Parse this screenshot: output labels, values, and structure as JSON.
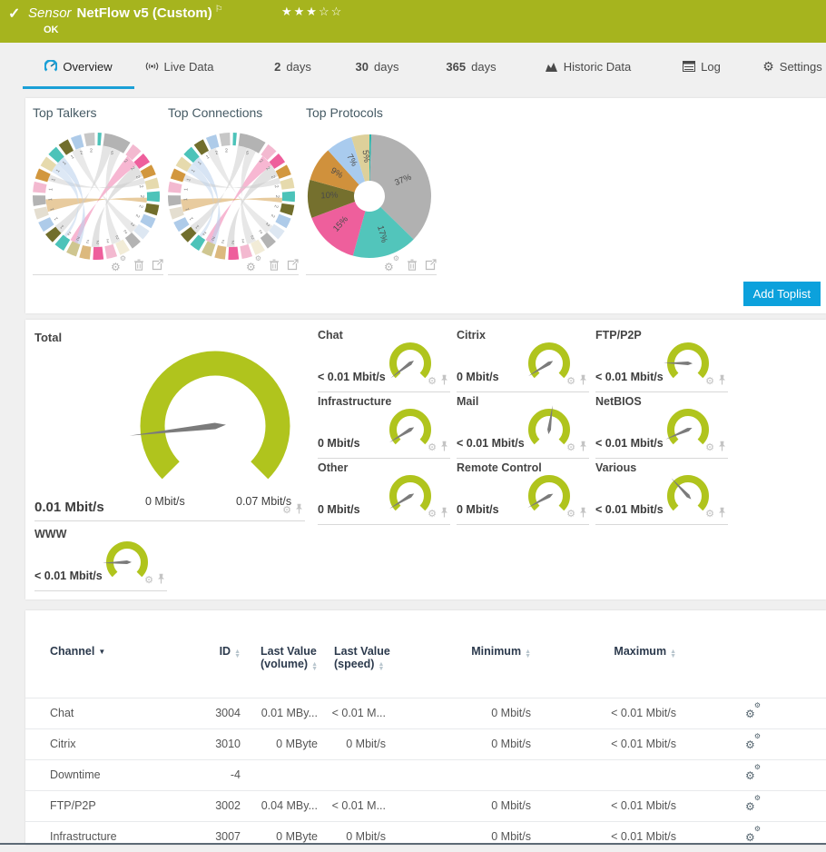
{
  "header": {
    "check_icon": "✓",
    "title_prefix": "Sensor",
    "title": "NetFlow v5 (Custom)",
    "flag_icon": "⚐",
    "stars": "★★★☆☆",
    "status": "OK"
  },
  "tabs": {
    "overview": "Overview",
    "live_data": "Live Data",
    "d2_num": "2",
    "d2_unit": "days",
    "d30_num": "30",
    "d30_unit": "days",
    "d365_num": "365",
    "d365_unit": "days",
    "historic": "Historic Data",
    "log": "Log",
    "settings": "Settings"
  },
  "toplists": {
    "talkers_title": "Top Talkers",
    "connections_title": "Top Connections",
    "protocols_title": "Top Protocols",
    "add_button": "Add Toplist"
  },
  "gauges": {
    "total": {
      "title": "Total",
      "value": "0.01 Mbit/s",
      "min_label": "0 Mbit/s",
      "max_label": "0.07 Mbit/s",
      "fraction": 0.143
    },
    "small": [
      {
        "title": "Chat",
        "value": "< 0.01 Mbit/s",
        "fraction": 0.03
      },
      {
        "title": "Citrix",
        "value": "0 Mbit/s",
        "fraction": 0.05
      },
      {
        "title": "FTP/P2P",
        "value": "< 0.01 Mbit/s",
        "fraction": 0.17
      },
      {
        "title": "Infrastructure",
        "value": "0 Mbit/s",
        "fraction": 0.05
      },
      {
        "title": "Mail",
        "value": "< 0.01 Mbit/s",
        "fraction": 0.53
      },
      {
        "title": "NetBIOS",
        "value": "< 0.01 Mbit/s",
        "fraction": 0.08
      },
      {
        "title": "Other",
        "value": "0 Mbit/s",
        "fraction": 0.05
      },
      {
        "title": "Remote Control",
        "value": "0 Mbit/s",
        "fraction": 0.06
      },
      {
        "title": "Various",
        "value": "< 0.01 Mbit/s",
        "fraction": 0.34
      },
      {
        "title": "WWW",
        "value": "< 0.01 Mbit/s",
        "fraction": 0.16
      }
    ]
  },
  "table": {
    "headers": {
      "channel": "Channel",
      "id": "ID",
      "lv_volume_1": "Last Value",
      "lv_volume_2": "(volume)",
      "lv_speed_1": "Last Value",
      "lv_speed_2": "(speed)",
      "minimum": "Minimum",
      "maximum": "Maximum"
    },
    "rows": [
      {
        "channel": "Chat",
        "id": "3004",
        "lv_volume": "0.01 MBy...",
        "lv_speed": "< 0.01 M...",
        "min": "0 Mbit/s",
        "max": "< 0.01 Mbit/s"
      },
      {
        "channel": "Citrix",
        "id": "3010",
        "lv_volume": "0 MByte",
        "lv_speed": "0 Mbit/s",
        "min": "0 Mbit/s",
        "max": "< 0.01 Mbit/s"
      },
      {
        "channel": "Downtime",
        "id": "-4",
        "lv_volume": "",
        "lv_speed": "",
        "min": "",
        "max": ""
      },
      {
        "channel": "FTP/P2P",
        "id": "3002",
        "lv_volume": "0.04 MBy...",
        "lv_speed": "< 0.01 M...",
        "min": "0 Mbit/s",
        "max": "< 0.01 Mbit/s"
      },
      {
        "channel": "Infrastructure",
        "id": "3007",
        "lv_volume": "0 MByte",
        "lv_speed": "0 Mbit/s",
        "min": "0 Mbit/s",
        "max": "< 0.01 Mbit/s"
      }
    ]
  },
  "chart_data": {
    "top_protocols": {
      "type": "pie",
      "title": "Top Protocols",
      "labels": [
        "",
        "37%",
        "17%",
        "15%",
        "10%",
        "9%",
        "7%",
        "5%"
      ],
      "values": [
        0.5,
        36.8,
        17,
        15,
        10,
        9,
        7,
        4.7
      ],
      "colors": [
        "#2ab5ab",
        "#b1b1b1",
        "#52c5bb",
        "#ee5f9c",
        "#75702e",
        "#d0913c",
        "#a9cbee",
        "#ddd09a"
      ]
    },
    "top_talkers": {
      "type": "chord",
      "title": "Top Talkers",
      "template": "chord_template"
    },
    "top_connections": {
      "type": "chord",
      "title": "Top Connections",
      "template": "chord_template"
    },
    "chord_template": {
      "segments": [
        {
          "c": "#4cc3b9",
          "w": 0.5,
          "label": ""
        },
        {
          "c": "#b3b3b3",
          "w": 2.2,
          "label": "5"
        },
        {
          "c": "#f3b9d0",
          "w": 1,
          "label": "2"
        },
        {
          "c": "#ee5f9c",
          "w": 1,
          "label": "2"
        },
        {
          "c": "#d2973e",
          "w": 1,
          "label": "2"
        },
        {
          "c": "#e6daad",
          "w": 1,
          "label": "2"
        },
        {
          "c": "#4cc3b9",
          "w": 1,
          "label": "2"
        },
        {
          "c": "#716e2c",
          "w": 1,
          "label": "2"
        },
        {
          "c": "#aecbe9",
          "w": 1,
          "label": "2"
        },
        {
          "c": "#dde7f2",
          "w": 1,
          "label": "2"
        },
        {
          "c": "#b3b3b3",
          "w": 1,
          "label": "2"
        },
        {
          "c": "#f2ecd7",
          "w": 1,
          "label": "2"
        },
        {
          "c": "#f3b9d0",
          "w": 1,
          "label": "2"
        },
        {
          "c": "#ee5f9c",
          "w": 1,
          "label": "2"
        },
        {
          "c": "#dcb97e",
          "w": 1,
          "label": "2"
        },
        {
          "c": "#cfc690",
          "w": 1,
          "label": "2"
        },
        {
          "c": "#4cc3b9",
          "w": 1,
          "label": "2"
        },
        {
          "c": "#716e2c",
          "w": 1,
          "label": "1"
        },
        {
          "c": "#aecbe9",
          "w": 1,
          "label": "1"
        },
        {
          "c": "#e4ded0",
          "w": 1,
          "label": "1"
        },
        {
          "c": "#b3b3b3",
          "w": 1,
          "label": "1"
        },
        {
          "c": "#f3b9d0",
          "w": 1,
          "label": "1"
        },
        {
          "c": "#d2973e",
          "w": 1,
          "label": "1"
        },
        {
          "c": "#e6daad",
          "w": 1,
          "label": "1"
        },
        {
          "c": "#4cc3b9",
          "w": 1,
          "label": "1"
        },
        {
          "c": "#716e2c",
          "w": 1,
          "label": "1"
        },
        {
          "c": "#aecbe9",
          "w": 1,
          "label": "2"
        },
        {
          "c": "#c7c7c7",
          "w": 1,
          "label": "2"
        }
      ],
      "chords": [
        {
          "a": [
            0.145,
            0.185
          ],
          "b": [
            0.49,
            0.515
          ],
          "c": "#c9c9c9",
          "o": 0.55
        },
        {
          "a": [
            0.105,
            0.145
          ],
          "b": [
            0.56,
            0.585
          ],
          "c": "#ee5f9c",
          "o": 0.45
        },
        {
          "a": [
            0.7,
            0.74
          ],
          "b": [
            0.255,
            0.27
          ],
          "c": "#d2973e",
          "o": 0.5
        },
        {
          "a": [
            0.02,
            0.05
          ],
          "b": [
            0.62,
            0.65
          ],
          "c": "#c9c9c9",
          "o": 0.5
        },
        {
          "a": [
            0.05,
            0.08
          ],
          "b": [
            0.42,
            0.45
          ],
          "c": "#d4d4d4",
          "o": 0.55
        },
        {
          "a": [
            0.86,
            0.89
          ],
          "b": [
            0.55,
            0.57
          ],
          "c": "#bcd2ec",
          "o": 0.6
        },
        {
          "a": [
            0.92,
            0.95
          ],
          "b": [
            0.35,
            0.38
          ],
          "c": "#d4d4d4",
          "o": 0.5
        },
        {
          "a": [
            0.19,
            0.21
          ],
          "b": [
            0.8,
            0.82
          ],
          "c": "#cccccc",
          "o": 0.5
        },
        {
          "a": [
            0.6,
            0.61
          ],
          "b": [
            0.83,
            0.86
          ],
          "c": "#bcd2ec",
          "o": 0.5
        }
      ]
    }
  },
  "colors": {
    "header_green": "#a6b41e",
    "gauge_green": "#b0c41d",
    "accent_blue": "#1ba0d7",
    "button_blue": "#0ca1dc",
    "needle_gray": "#7b7b7b"
  }
}
